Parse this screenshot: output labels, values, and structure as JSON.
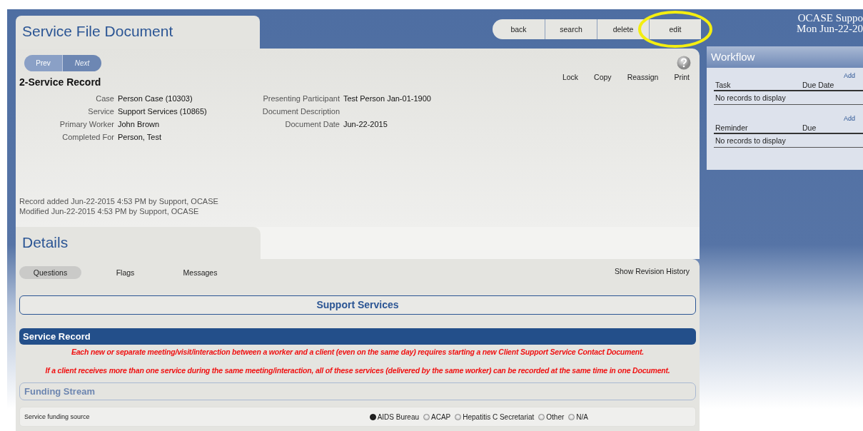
{
  "header": {
    "title": "Service File Document",
    "buttons": [
      {
        "label": "back",
        "circled": false
      },
      {
        "label": "search",
        "circled": false
      },
      {
        "label": "delete",
        "circled": false
      },
      {
        "label": "edit",
        "circled": true
      }
    ]
  },
  "user_info": [
    "OCASE Suppo",
    "Mon Jun-22-20"
  ],
  "record": {
    "pager": [
      {
        "label": "Prev",
        "disabled": false
      },
      {
        "label": "Next",
        "disabled": true
      }
    ],
    "actions": [
      "Lock",
      "Copy",
      "Reassign",
      "Print"
    ],
    "heading": "2-Service Record",
    "fields_left": [
      {
        "label": "Case",
        "value": "Person Case (10303)"
      },
      {
        "label": "Service",
        "value": "Support Services (10865)"
      },
      {
        "label": "Primary Worker",
        "value": "John Brown"
      },
      {
        "label": "Completed For",
        "value": "Person, Test"
      }
    ],
    "fields_right": [
      {
        "label": "Presenting Participant",
        "value": "Test Person Jan-01-1900"
      },
      {
        "label": "Document Description"
      },
      {
        "label": "Document Date",
        "value": "Jun-22-2015"
      }
    ],
    "audit": [
      "Record added Jun-22-2015 4:53 PM by Support, OCASE",
      "Modified Jun-22-2015 4:53 PM by Support, OCASE"
    ]
  },
  "details": {
    "title": "Details",
    "tabs": [
      {
        "label": "Questions",
        "selected": true
      },
      {
        "label": "Flags",
        "selected": false
      },
      {
        "label": "Messages",
        "selected": false
      }
    ],
    "revision_link": "Show Revision History",
    "form_title": "Support Services",
    "section": "Service Record",
    "notes": [
      "Each new or separate meeting/visit/interaction between a worker and a client (even on the same day) requires starting a new Client Support Service Contact Document.",
      "If a client receives more than one service during the same meeting/interaction, all of these services (delivered by the same worker) can be recorded at the same time in one Document."
    ],
    "subsection": "Funding Stream",
    "question": {
      "label": "Service funding source",
      "options": [
        {
          "label": "AIDS Bureau",
          "selected": true
        },
        {
          "label": "ACAP",
          "selected": false
        },
        {
          "label": "Hepatitis C Secretariat",
          "selected": false
        },
        {
          "label": "Other",
          "selected": false
        },
        {
          "label": "N/A",
          "selected": false
        }
      ]
    }
  },
  "workflow": {
    "title": "Workflow",
    "tables": [
      {
        "add": "Add",
        "columns": [
          "Task",
          "Due Date"
        ],
        "empty": "No records to display"
      },
      {
        "add": "Add",
        "columns": [
          "Reminder",
          "Due"
        ],
        "empty": "No records to display"
      }
    ]
  }
}
